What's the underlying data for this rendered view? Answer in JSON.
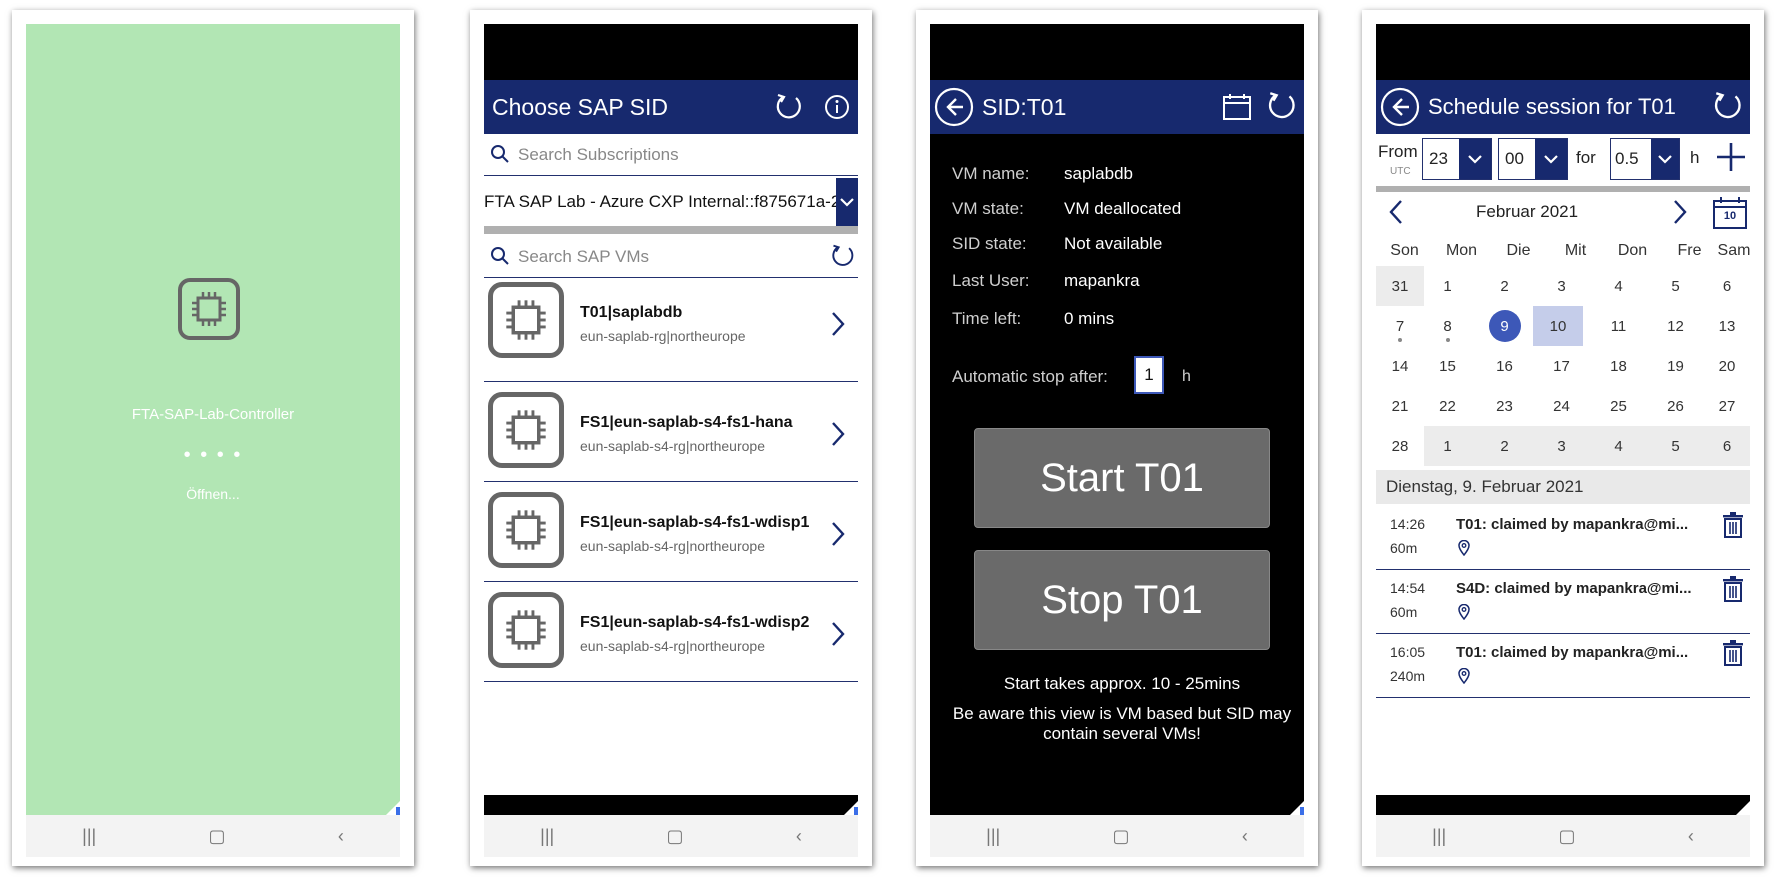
{
  "screen1": {
    "app_name": "FTA-SAP-Lab-Controller",
    "dots": "• • • •",
    "status": "Öffnen..."
  },
  "screen2": {
    "title": "Choose SAP SID",
    "subscription_search_placeholder": "Search Subscriptions",
    "subscription_selected": "FTA SAP Lab - Azure CXP Internal::f875671a-2",
    "vm_search_placeholder": "Search SAP VMs",
    "items": [
      {
        "title": "T01|saplabdb",
        "sub": "eun-saplab-rg|northeurope"
      },
      {
        "title": "FS1|eun-saplab-s4-fs1-hana",
        "sub": "eun-saplab-s4-rg|northeurope"
      },
      {
        "title": "FS1|eun-saplab-s4-fs1-wdisp1",
        "sub": "eun-saplab-s4-rg|northeurope"
      },
      {
        "title": "FS1|eun-saplab-s4-fs1-wdisp2",
        "sub": "eun-saplab-s4-rg|northeurope"
      }
    ]
  },
  "screen3": {
    "title": "SID:T01",
    "vm_name_label": "VM name:",
    "vm_name": "saplabdb",
    "vm_state_label": "VM state:",
    "vm_state": "VM deallocated",
    "sid_state_label": "SID state:",
    "sid_state": "Not available",
    "last_user_label": "Last User:",
    "last_user": "mapankra",
    "time_left_label": "Time left:",
    "time_left": "0 mins",
    "auto_stop_label": "Automatic stop after:",
    "auto_stop_value": "1",
    "auto_stop_unit": "h",
    "start_button": "Start T01",
    "stop_button": "Stop T01",
    "note1": "Start takes approx. 10 - 25mins",
    "note2": "Be aware this view is VM based but SID may contain several VMs!"
  },
  "screen4": {
    "title": "Schedule session for T01",
    "from_label": "From",
    "utc_label": "UTC",
    "hour": "23",
    "minute": "00",
    "for_label": "for",
    "duration": "0.5",
    "unit": "h",
    "month": "Februar 2021",
    "calendar_icon_day": "10",
    "weekdays": [
      "Son",
      "Mon",
      "Die",
      "Mit",
      "Don",
      "Fre",
      "Sam"
    ],
    "weeks": [
      [
        "31",
        "1",
        "2",
        "3",
        "4",
        "5",
        "6"
      ],
      [
        "7",
        "8",
        "9",
        "10",
        "11",
        "12",
        "13"
      ],
      [
        "14",
        "15",
        "16",
        "17",
        "18",
        "19",
        "20"
      ],
      [
        "21",
        "22",
        "23",
        "24",
        "25",
        "26",
        "27"
      ],
      [
        "28",
        "1",
        "2",
        "3",
        "4",
        "5",
        "6"
      ]
    ],
    "selected_date_label": "Dienstag, 9. Februar 2021",
    "sessions": [
      {
        "time": "14:26",
        "duration": "60m",
        "text": "T01: claimed by mapankra@mi..."
      },
      {
        "time": "14:54",
        "duration": "60m",
        "text": "S4D: claimed by mapankra@mi..."
      },
      {
        "time": "16:05",
        "duration": "240m",
        "text": "T01: claimed by mapankra@mi..."
      }
    ]
  },
  "colors": {
    "splash_bg": "#b2e6b4",
    "header_bg": "#17296e",
    "accent": "#3d58b8"
  }
}
